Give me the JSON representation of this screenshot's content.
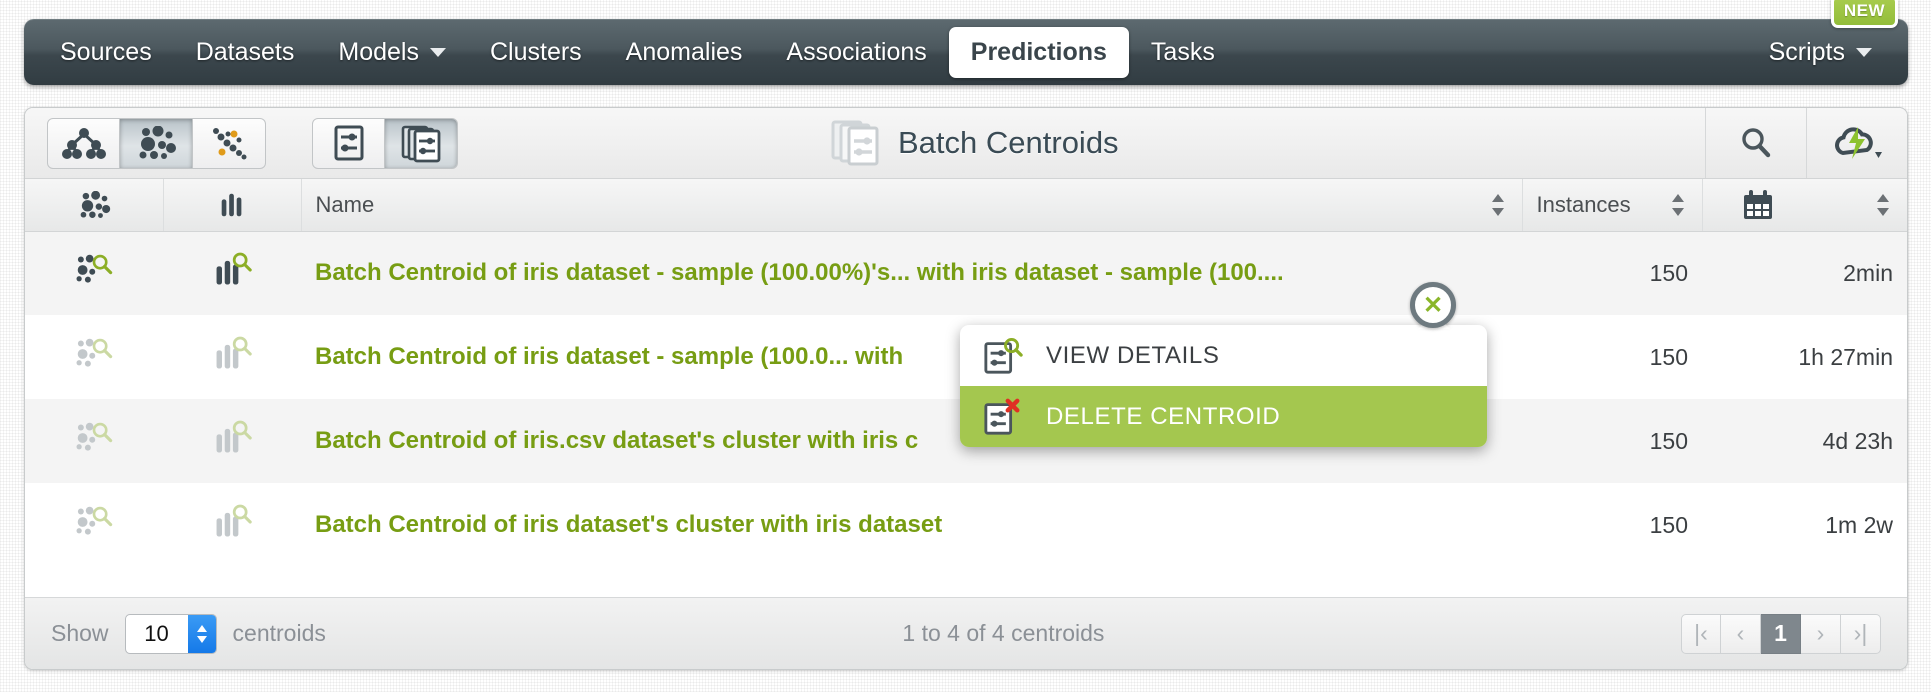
{
  "topnav": {
    "items": [
      {
        "label": "Sources",
        "icon": null,
        "active": false,
        "dropdown": false
      },
      {
        "label": "Datasets",
        "icon": null,
        "active": false,
        "dropdown": false
      },
      {
        "label": "Models",
        "icon": "chevron-down-icon",
        "active": false,
        "dropdown": true
      },
      {
        "label": "Clusters",
        "icon": null,
        "active": false,
        "dropdown": false
      },
      {
        "label": "Anomalies",
        "icon": null,
        "active": false,
        "dropdown": false
      },
      {
        "label": "Associations",
        "icon": null,
        "active": false,
        "dropdown": false
      },
      {
        "label": "Predictions",
        "icon": null,
        "active": true,
        "dropdown": false
      },
      {
        "label": "Tasks",
        "icon": null,
        "active": false,
        "dropdown": false
      }
    ],
    "scripts_label": "Scripts",
    "new_badge": "NEW"
  },
  "toolbar": {
    "resource_buttons": [
      {
        "name": "model-tree-icon",
        "selected": false
      },
      {
        "name": "cluster-icon",
        "selected": true
      },
      {
        "name": "anomaly-icon",
        "selected": false
      }
    ],
    "mode_buttons": [
      {
        "name": "single-prediction-icon",
        "selected": false
      },
      {
        "name": "batch-prediction-icon",
        "selected": true
      }
    ],
    "title": "Batch Centroids",
    "title_icon": "batch-centroid-icon",
    "search_icon": "search-icon",
    "quick_action_icon": "cloud-bolt-icon"
  },
  "table": {
    "columns": [
      {
        "key": "cluster",
        "label": "",
        "icon": "cluster-icon",
        "sortable": false
      },
      {
        "key": "dataset",
        "label": "",
        "icon": "dataset-bars-icon",
        "sortable": false
      },
      {
        "key": "name",
        "label": "Name",
        "icon": null,
        "sortable": true
      },
      {
        "key": "instances",
        "label": "Instances",
        "icon": null,
        "sortable": true
      },
      {
        "key": "age",
        "label": "",
        "icon": "calendar-icon",
        "sortable": true
      }
    ],
    "rows": [
      {
        "name": "Batch Centroid of iris dataset - sample (100.00%)'s... with iris dataset - sample (100....",
        "instances": "150",
        "age": "2min",
        "icons_active": true,
        "has_menu_open": true
      },
      {
        "name": "Batch Centroid of iris dataset - sample (100.0... with",
        "instances": "150",
        "age": "1h 27min",
        "icons_active": false,
        "has_menu_open": false
      },
      {
        "name": "Batch Centroid of iris.csv dataset's cluster with iris c",
        "instances": "150",
        "age": "4d 23h",
        "icons_active": false,
        "has_menu_open": false
      },
      {
        "name": "Batch Centroid of iris dataset's cluster with iris dataset",
        "instances": "150",
        "age": "1m 2w",
        "icons_active": false,
        "has_menu_open": false
      }
    ]
  },
  "context_menu": {
    "items": [
      {
        "label": "VIEW DETAILS",
        "icon": "view-details-icon",
        "highlighted": false
      },
      {
        "label": "DELETE CENTROID",
        "icon": "delete-centroid-icon",
        "highlighted": true
      }
    ]
  },
  "footer": {
    "show_label": "Show",
    "page_size": "10",
    "unit_label": "centroids",
    "range_text": "1 to 4 of 4 centroids",
    "pager": [
      {
        "glyph": "|‹",
        "name": "first-page-button",
        "current": false
      },
      {
        "glyph": "‹",
        "name": "prev-page-button",
        "current": false
      },
      {
        "glyph": "1",
        "name": "page-1-button",
        "current": true
      },
      {
        "glyph": "›",
        "name": "next-page-button",
        "current": false
      },
      {
        "glyph": "›|",
        "name": "last-page-button",
        "current": false
      }
    ]
  },
  "colors": {
    "nav_dark": "#3c474d",
    "accent_green": "#779d13",
    "highlight_green": "#a4c74f",
    "badge_green": "#93bd3a",
    "text_dark": "#3b3f42"
  }
}
